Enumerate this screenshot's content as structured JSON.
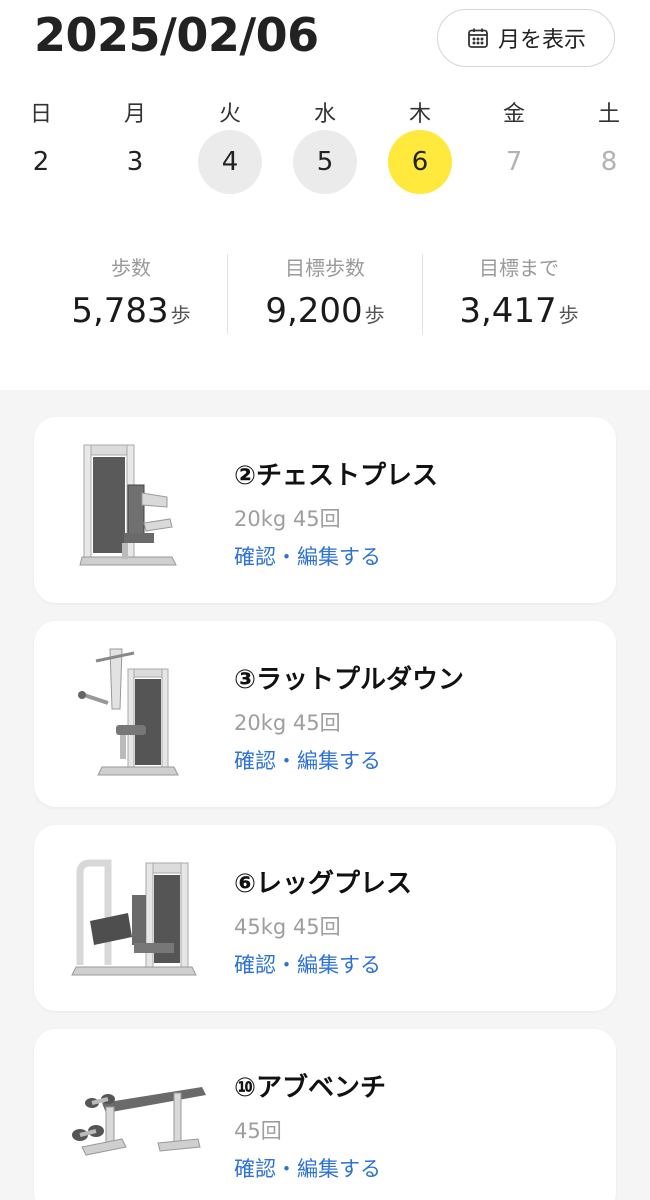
{
  "header": {
    "date": "2025/02/06",
    "month_button_label": "月を表示"
  },
  "week": [
    {
      "dow": "日",
      "day": "2",
      "state": "none"
    },
    {
      "dow": "月",
      "day": "3",
      "state": "none"
    },
    {
      "dow": "火",
      "day": "4",
      "state": "done"
    },
    {
      "dow": "水",
      "day": "5",
      "state": "done"
    },
    {
      "dow": "木",
      "day": "6",
      "state": "today"
    },
    {
      "dow": "金",
      "day": "7",
      "state": "future"
    },
    {
      "dow": "土",
      "day": "8",
      "state": "future"
    }
  ],
  "stats": [
    {
      "label": "歩数",
      "value": "5,783",
      "unit": "歩"
    },
    {
      "label": "目標歩数",
      "value": "9,200",
      "unit": "歩"
    },
    {
      "label": "目標まで",
      "value": "3,417",
      "unit": "歩"
    }
  ],
  "workouts": [
    {
      "title": "②チェストプレス",
      "meta": "20kg 45回",
      "link": "確認・編集する",
      "icon": "chest-press-machine"
    },
    {
      "title": "③ラットプルダウン",
      "meta": "20kg 45回",
      "link": "確認・編集する",
      "icon": "lat-pulldown-machine"
    },
    {
      "title": "⑥レッグプレス",
      "meta": "45kg 45回",
      "link": "確認・編集する",
      "icon": "leg-press-machine"
    },
    {
      "title": "⑩アブベンチ",
      "meta": "45回",
      "link": "確認・編集する",
      "icon": "ab-bench"
    }
  ],
  "colors": {
    "today_highlight": "#ffe93c",
    "done_highlight": "#ebebeb",
    "link": "#2f72d6",
    "list_background": "#f5f5f5"
  }
}
